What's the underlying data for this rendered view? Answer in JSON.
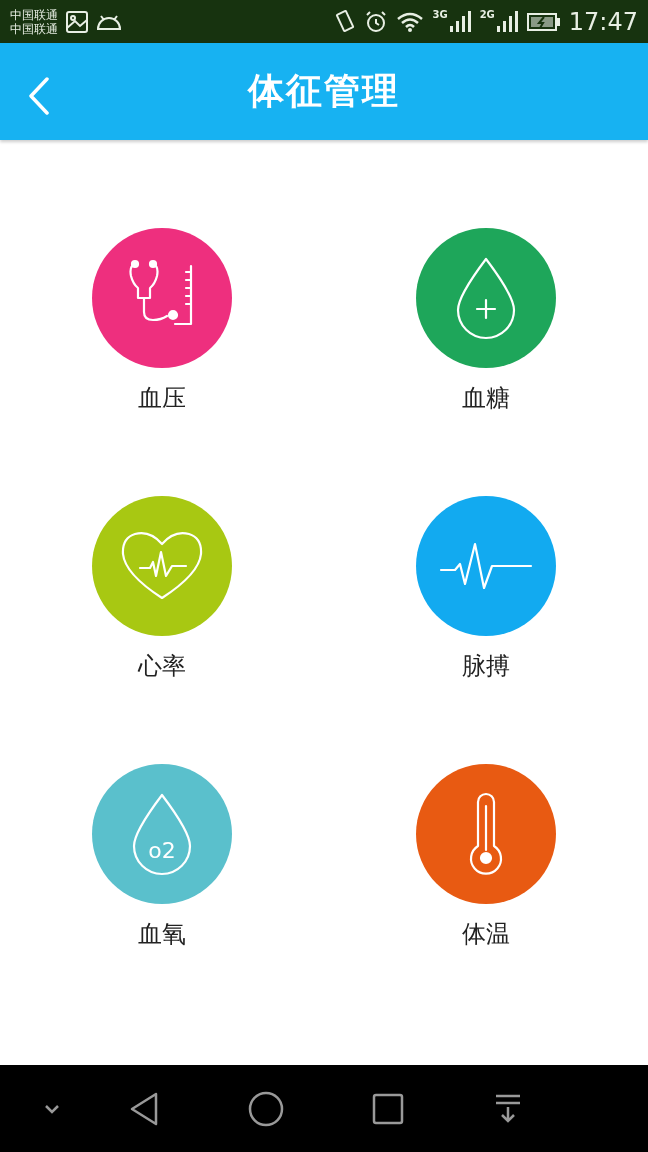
{
  "status_bar": {
    "carriers": [
      "中国联通",
      "中国联通"
    ],
    "network_labels": [
      "3G",
      "2G"
    ],
    "time": "17:47"
  },
  "header": {
    "title": "体征管理"
  },
  "items": [
    {
      "label": "血压",
      "kind": "stethoscope",
      "color": "#ee2f7e"
    },
    {
      "label": "血糖",
      "kind": "drop-plus",
      "color": "#1ea65a"
    },
    {
      "label": "心率",
      "kind": "heart-pulse",
      "color": "#a8c812"
    },
    {
      "label": "脉搏",
      "kind": "pulse",
      "color": "#12aaf0"
    },
    {
      "label": "血氧",
      "kind": "drop-text",
      "color": "#5ac0cc",
      "icon_text": "o2"
    },
    {
      "label": "体温",
      "kind": "thermometer",
      "color": "#e85a12"
    }
  ]
}
